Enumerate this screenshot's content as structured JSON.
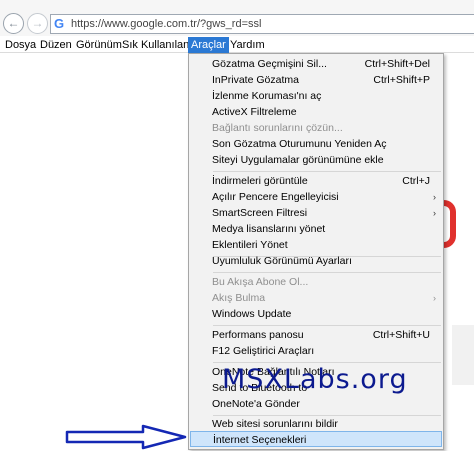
{
  "browser": {
    "url": "https://www.google.com.tr/?gws_rd=ssl"
  },
  "menubar": {
    "items": [
      {
        "label": "Dosya",
        "active": false
      },
      {
        "label": "Düzen",
        "active": false
      },
      {
        "label": "Görünüm",
        "active": false
      },
      {
        "label": "Sık Kullanılanlar",
        "active": false
      },
      {
        "label": "Araçlar",
        "active": true
      },
      {
        "label": "Yardım",
        "active": false
      }
    ]
  },
  "tools_menu": {
    "items": [
      {
        "label": "Gözatma Geçmişini Sil...",
        "shortcut": "Ctrl+Shift+Del",
        "enabled": true
      },
      {
        "label": "InPrivate Gözatma",
        "shortcut": "Ctrl+Shift+P",
        "enabled": true
      },
      {
        "label": "İzlenme Koruması'nı aç",
        "shortcut": "",
        "enabled": true
      },
      {
        "label": "ActiveX Filtreleme",
        "shortcut": "",
        "enabled": true
      },
      {
        "label": "Bağlantı sorunlarını çözün...",
        "shortcut": "",
        "enabled": false
      },
      {
        "label": "Son Gözatma Oturumunu Yeniden Aç",
        "shortcut": "",
        "enabled": true
      },
      {
        "label": "Siteyi Uygulamalar görünümüne ekle",
        "shortcut": "",
        "enabled": true
      },
      {
        "label": "İndirmeleri görüntüle",
        "shortcut": "Ctrl+J",
        "enabled": true
      },
      {
        "label": "Açılır Pencere Engelleyicisi",
        "shortcut": "",
        "enabled": true,
        "submenu": true
      },
      {
        "label": "SmartScreen Filtresi",
        "shortcut": "",
        "enabled": true,
        "submenu": true
      },
      {
        "label": "Medya lisanslarını yönet",
        "shortcut": "",
        "enabled": true
      },
      {
        "label": "Eklentileri Yönet",
        "shortcut": "",
        "enabled": true
      },
      {
        "label": "Uyumluluk Görünümü Ayarları",
        "shortcut": "",
        "enabled": true
      },
      {
        "label": "Bu Akışa Abone Ol...",
        "shortcut": "",
        "enabled": false
      },
      {
        "label": "Akış Bulma",
        "shortcut": "",
        "enabled": false,
        "submenu": true
      },
      {
        "label": "Windows Update",
        "shortcut": "",
        "enabled": true
      },
      {
        "label": "Performans panosu",
        "shortcut": "Ctrl+Shift+U",
        "enabled": true
      },
      {
        "label": "F12 Geliştirici Araçları",
        "shortcut": "",
        "enabled": true
      },
      {
        "label": "OneNote Bağlantılı Notları",
        "shortcut": "",
        "enabled": true
      },
      {
        "label": "Send to Bluetooth to",
        "shortcut": "",
        "enabled": true
      },
      {
        "label": "OneNote'a Gönder",
        "shortcut": "",
        "enabled": true
      },
      {
        "label": "Web sitesi sorunlarını bildir",
        "shortcut": "",
        "enabled": true
      },
      {
        "label": "İnternet Seçenekleri",
        "shortcut": "",
        "enabled": true,
        "highlighted": true
      }
    ],
    "submenu_glyph": "›"
  },
  "watermark": "MSXLabs.org",
  "icons": {
    "back": "back-arrow-icon",
    "forward": "forward-arrow-icon",
    "site": "google-g-icon",
    "pointer": "blue-arrow-icon"
  },
  "colors": {
    "menu_active": "#2b79d4",
    "menu_highlight": "#cfe5fb",
    "watermark": "#0c1a8f",
    "arrow": "#1428b4"
  }
}
